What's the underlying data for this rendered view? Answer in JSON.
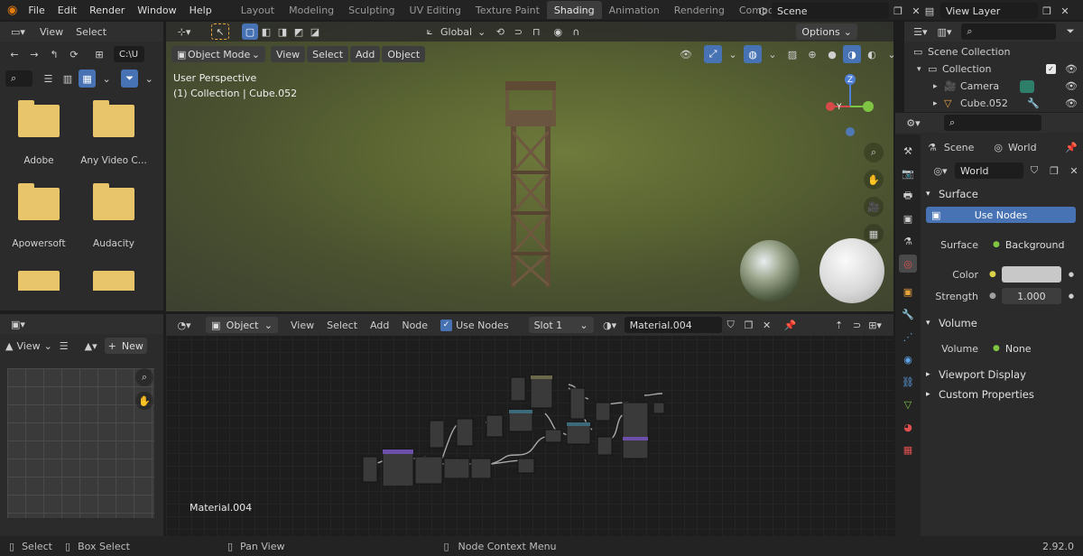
{
  "menus": [
    "File",
    "Edit",
    "Render",
    "Window",
    "Help"
  ],
  "workspaces": [
    "Layout",
    "Modeling",
    "Sculpting",
    "UV Editing",
    "Texture Paint",
    "Shading",
    "Animation",
    "Rendering",
    "Compos"
  ],
  "active_workspace": "Shading",
  "scene_field": "Scene",
  "view_layer_field": "View Layer",
  "filebrowser": {
    "header": {
      "view": "View",
      "select": "Select"
    },
    "path": "C:\\U",
    "items": [
      {
        "label": "Adobe"
      },
      {
        "label": "Any Video C..."
      },
      {
        "label": "Apowersoft"
      },
      {
        "label": "Audacity"
      },
      {
        "label": ""
      },
      {
        "label": ""
      }
    ]
  },
  "viewport": {
    "mode": "Object Mode",
    "menus": [
      "View",
      "Select",
      "Add",
      "Object"
    ],
    "orientation": "Global",
    "options": "Options",
    "info_line1": "User Perspective",
    "info_line2": "(1) Collection | Cube.052",
    "gizmo": {
      "z": "Z",
      "y": "Y"
    }
  },
  "image_editor": {
    "view": "View",
    "new": "New"
  },
  "node_editor": {
    "type": "Object",
    "menus": [
      "View",
      "Select",
      "Add",
      "Node"
    ],
    "use_nodes": "Use Nodes",
    "slot": "Slot 1",
    "material": "Material.004",
    "material_label": "Material.004"
  },
  "outliner": {
    "search_placeholder": "",
    "items": [
      {
        "label": "Scene Collection",
        "indent": 0
      },
      {
        "label": "Collection",
        "indent": 1
      },
      {
        "label": "Camera",
        "indent": 2
      },
      {
        "label": "Cube.052",
        "indent": 2
      }
    ]
  },
  "properties": {
    "tabs": [
      "Scene",
      "World"
    ],
    "world_name": "World",
    "surface_panel": "Surface",
    "use_nodes": "Use Nodes",
    "surface_label": "Surface",
    "surface_value": "Background",
    "color_label": "Color",
    "strength_label": "Strength",
    "strength_value": "1.000",
    "volume_panel": "Volume",
    "volume_label": "Volume",
    "volume_value": "None",
    "viewport_display": "Viewport Display",
    "custom_properties": "Custom Properties"
  },
  "statusbar": {
    "select": "Select",
    "box_select": "Box Select",
    "pan_view": "Pan View",
    "context_menu": "Node Context Menu",
    "version": "2.92.0"
  },
  "colors": {
    "accent": "#4772b3",
    "active_tab": "#3c3c3c",
    "panel": "#2b2b2b",
    "bg": "#1d1d1d"
  }
}
